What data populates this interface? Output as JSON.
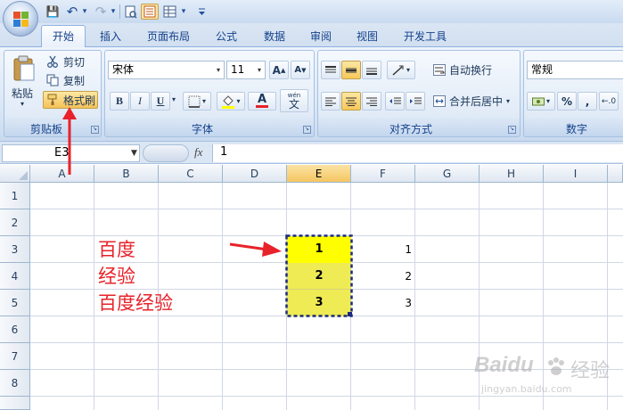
{
  "quick_access": {
    "save": "💾",
    "undo": "↶",
    "redo": "↷",
    "dropdown": "▾"
  },
  "tabs": [
    "开始",
    "插入",
    "页面布局",
    "公式",
    "数据",
    "审阅",
    "视图",
    "开发工具"
  ],
  "clipboard": {
    "paste": "粘贴",
    "cut": "剪切",
    "copy": "复制",
    "format_painter": "格式刷",
    "title": "剪贴板"
  },
  "font": {
    "name": "宋体",
    "size": "11",
    "grow": "A",
    "shrink": "A",
    "bold": "B",
    "italic": "I",
    "underline": "U",
    "font_color_letter": "A",
    "phonetic": "wén",
    "phonetic_char": "文",
    "title": "字体"
  },
  "alignment": {
    "wrap": "自动换行",
    "merge": "合并后居中",
    "title": "对齐方式"
  },
  "number": {
    "format": "常规",
    "percent": "%",
    "comma": ",",
    "title": "数字"
  },
  "formula_bar": {
    "cell_ref": "E3",
    "fx": "fx",
    "value": "1"
  },
  "columns": [
    "A",
    "B",
    "C",
    "D",
    "E",
    "F",
    "G",
    "H",
    "I"
  ],
  "rows": [
    "1",
    "2",
    "3",
    "4",
    "5",
    "6",
    "7",
    "8"
  ],
  "cells": {
    "b3": "百度",
    "b4": "经验",
    "b5": "百度经验",
    "e3": "1",
    "e4": "2",
    "e5": "3",
    "f3": "1",
    "f4": "2",
    "f5": "3"
  },
  "watermark": {
    "brand": "Baidu",
    "sub": "经验",
    "url": "jingyan.baidu.com"
  },
  "colors": {
    "accent_red": "#e8222a",
    "cell_yellow": "#ffff00",
    "cell_yellow_light": "#eeeb55",
    "selection": "#f5c662"
  }
}
